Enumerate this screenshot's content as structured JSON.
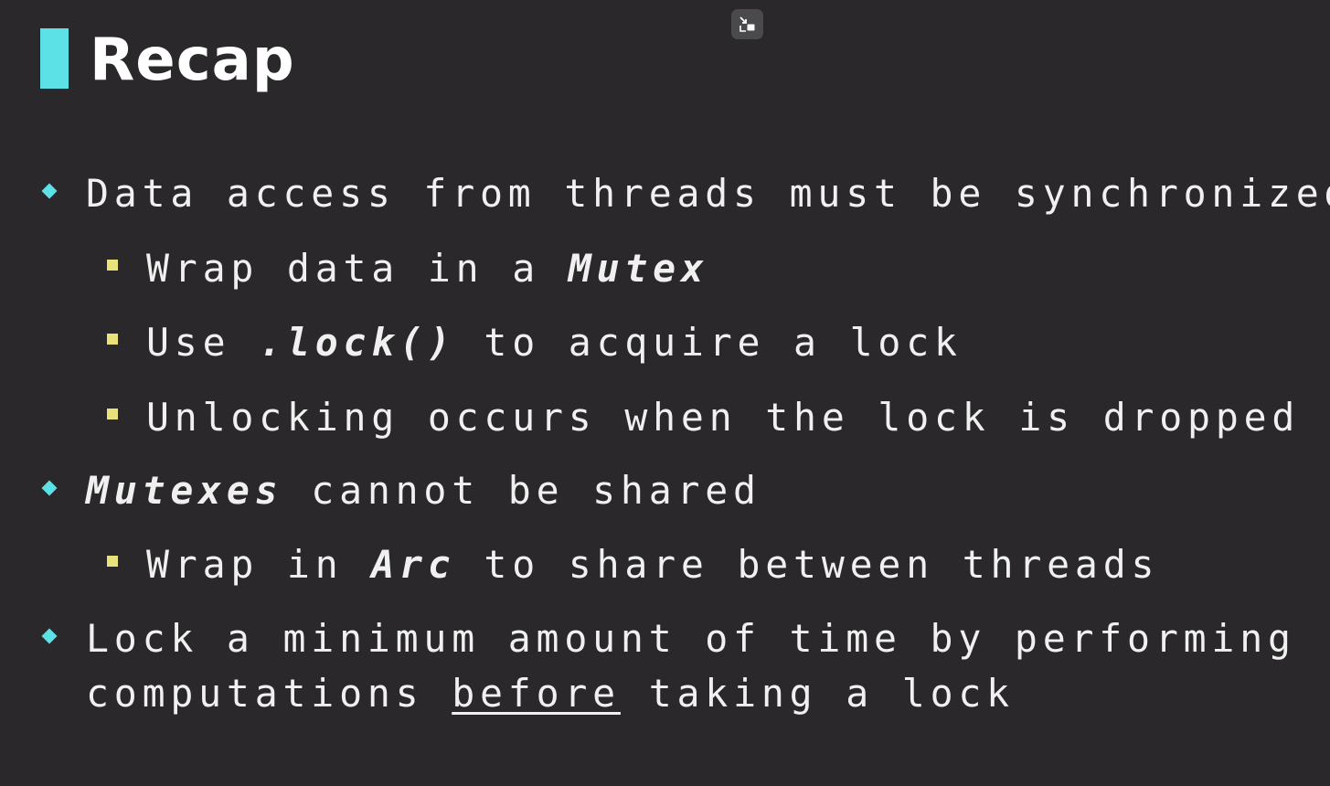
{
  "slide": {
    "title": "Recap",
    "accent_color": "#5ce1e6",
    "sub_bullet_color": "#e9e27a",
    "background_color": "#2a282b"
  },
  "controls": {
    "exit_fullscreen_icon": "exit-fullscreen-icon"
  },
  "bullets": {
    "b1": {
      "text": "Data access from threads must be synchronized"
    },
    "b1_1": {
      "pre": "Wrap data in a ",
      "em": "Mutex"
    },
    "b1_2": {
      "pre": "Use ",
      "em": ".lock()",
      "post": " to acquire a lock"
    },
    "b1_3": {
      "text": "Unlocking occurs when the lock is dropped"
    },
    "b2": {
      "em": "Mutexes",
      "post": " cannot be shared"
    },
    "b2_1": {
      "pre": "Wrap in ",
      "em": "Arc",
      "post": " to share between threads"
    },
    "b3": {
      "line1": "Lock a minimum amount of time by performing",
      "line2_pre": "computations ",
      "line2_ul": "before",
      "line2_post": " taking a lock"
    }
  }
}
